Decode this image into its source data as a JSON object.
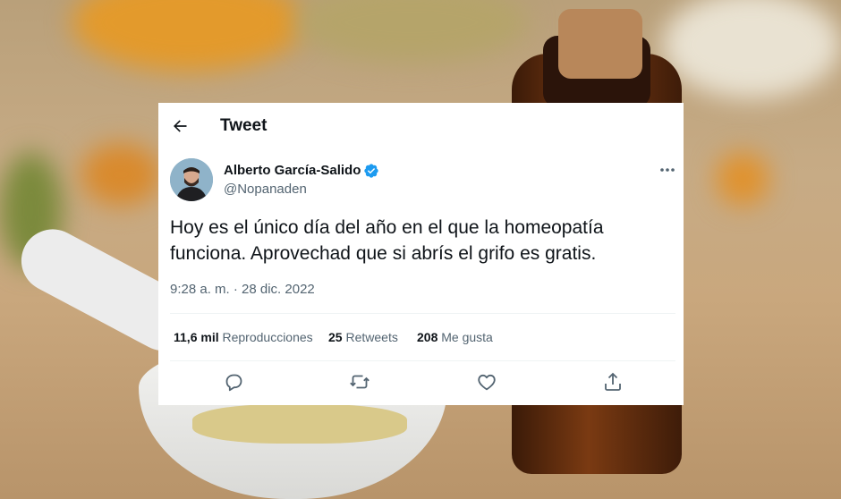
{
  "header": {
    "title": "Tweet"
  },
  "author": {
    "name": "Alberto García-Salido",
    "handle": "@Nopanaden"
  },
  "tweet": {
    "text_line1": "Hoy es el único día del año en el que la homeopatía",
    "text_line2": "funciona. Aprovechad que si abrís el grifo es gratis.",
    "timestamp": "9:28 a. m. · 28 dic. 2022"
  },
  "stats": {
    "views_count": "11,6 mil",
    "views_label": "Reproducciones",
    "retweets_count": "25",
    "retweets_label": "Retweets",
    "likes_count": "208",
    "likes_label": "Me gusta"
  },
  "colors": {
    "verified": "#1d9bf0",
    "text": "#0f1419",
    "secondary": "#536471"
  },
  "icons": [
    "back-arrow-icon",
    "verified-badge-icon",
    "more-icon",
    "reply-icon",
    "retweet-icon",
    "like-icon",
    "share-icon"
  ]
}
